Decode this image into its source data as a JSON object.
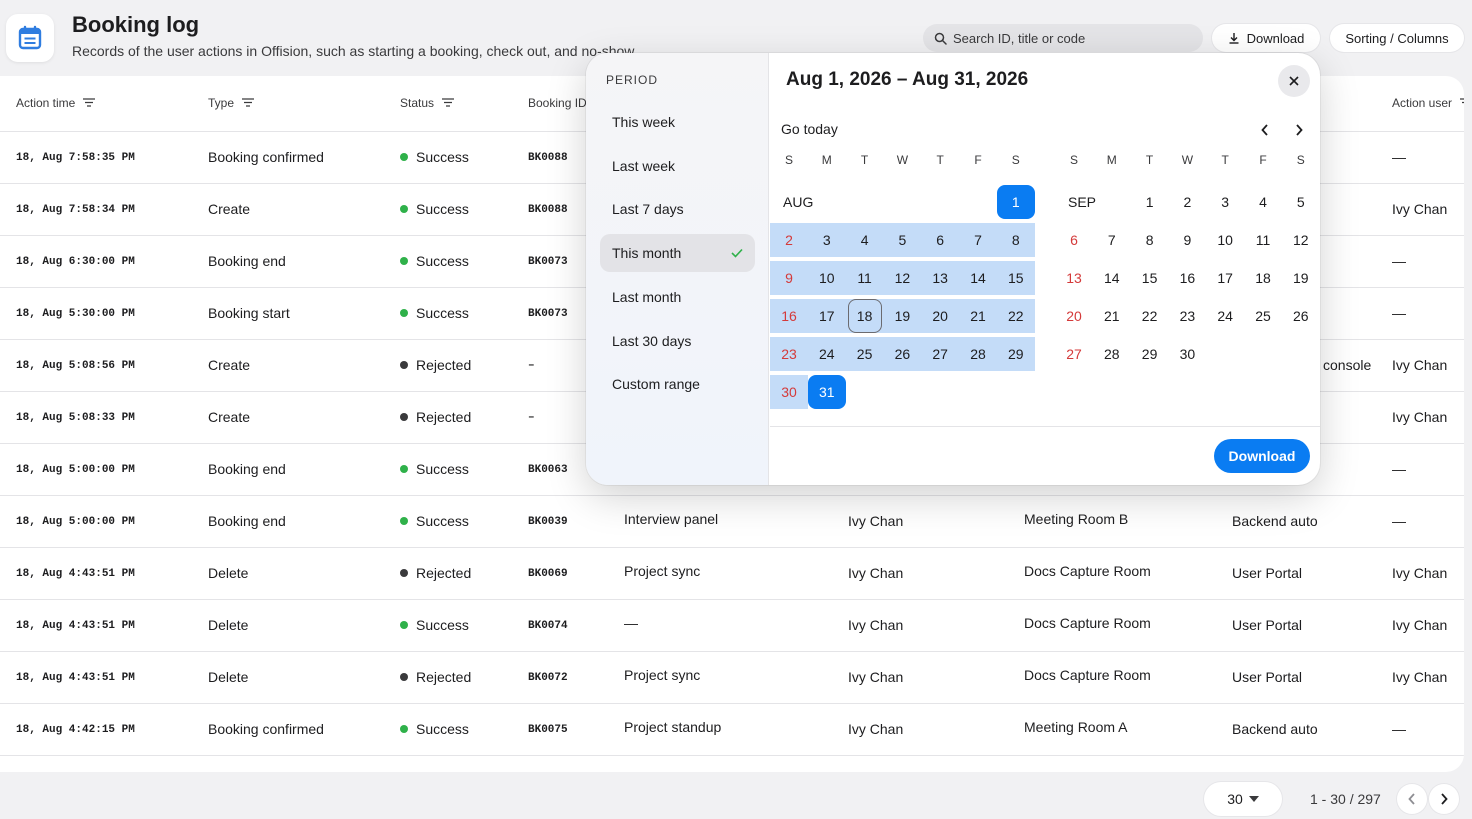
{
  "header": {
    "title": "Booking log",
    "subtitle": "Records of the user actions in Offision, such as starting a booking, check out, and no-show.",
    "search_placeholder": "Search ID, title or code",
    "download_label": "Download",
    "sorting_label": "Sorting / Columns"
  },
  "columns": {
    "action_time": "Action time",
    "type": "Type",
    "status": "Status",
    "booking_id": "Booking ID",
    "action_user": "Action user"
  },
  "rows": [
    {
      "time": "18, Aug 7:58:35 PM",
      "type": "Booking confirmed",
      "status": "Success",
      "code": "BK0088",
      "title": "",
      "user": "",
      "room": "",
      "source": "",
      "action_user": "—"
    },
    {
      "time": "18, Aug 7:58:34 PM",
      "type": "Create",
      "status": "Success",
      "code": "BK0088",
      "title": "",
      "user": "",
      "room": "",
      "source": "",
      "action_user": "Ivy Chan"
    },
    {
      "time": "18, Aug 6:30:00 PM",
      "type": "Booking end",
      "status": "Success",
      "code": "BK0073",
      "title": "",
      "user": "",
      "room": "",
      "source": "",
      "action_user": "—"
    },
    {
      "time": "18, Aug 5:30:00 PM",
      "type": "Booking start",
      "status": "Success",
      "code": "BK0073",
      "title": "",
      "user": "",
      "room": "",
      "source": "",
      "action_user": "—"
    },
    {
      "time": "18, Aug 5:08:56 PM",
      "type": "Create",
      "status": "Rejected",
      "code": "–",
      "title": "",
      "user": "",
      "room": "",
      "source": "console",
      "action_user": "Ivy Chan"
    },
    {
      "time": "18, Aug 5:08:33 PM",
      "type": "Create",
      "status": "Rejected",
      "code": "–",
      "title": "",
      "user": "",
      "room": "",
      "source": "",
      "action_user": "Ivy Chan"
    },
    {
      "time": "18, Aug 5:00:00 PM",
      "type": "Booking end",
      "status": "Success",
      "code": "BK0063",
      "title": "",
      "user": "",
      "room": "",
      "source": "",
      "action_user": "—"
    },
    {
      "time": "18, Aug 5:00:00 PM",
      "type": "Booking end",
      "status": "Success",
      "code": "BK0039",
      "title": "Interview panel",
      "user": "Ivy Chan",
      "room": "Meeting Room B",
      "source": "Backend auto",
      "action_user": "—"
    },
    {
      "time": "18, Aug 4:43:51 PM",
      "type": "Delete",
      "status": "Rejected",
      "code": "BK0069",
      "title": "Project sync",
      "user": "Ivy Chan",
      "room": "Docs Capture Room",
      "source": "User Portal",
      "action_user": "Ivy Chan"
    },
    {
      "time": "18, Aug 4:43:51 PM",
      "type": "Delete",
      "status": "Success",
      "code": "BK0074",
      "title": "—",
      "user": "Ivy Chan",
      "room": "Docs Capture Room",
      "source": "User Portal",
      "action_user": "Ivy Chan"
    },
    {
      "time": "18, Aug 4:43:51 PM",
      "type": "Delete",
      "status": "Rejected",
      "code": "BK0072",
      "title": "Project sync",
      "user": "Ivy Chan",
      "room": "Docs Capture Room",
      "source": "User Portal",
      "action_user": "Ivy Chan"
    },
    {
      "time": "18, Aug 4:42:15 PM",
      "type": "Booking confirmed",
      "status": "Success",
      "code": "BK0075",
      "title": "Project standup",
      "user": "Ivy Chan",
      "room": "Meeting Room A",
      "source": "Backend auto",
      "action_user": "—"
    }
  ],
  "status_colors": {
    "Success": "#2fb14a",
    "Rejected": "#3a3a3c"
  },
  "pagination": {
    "page_size": "30",
    "range": "1 - 30 / 297"
  },
  "popover": {
    "period_label": "PERIOD",
    "periods": [
      "This week",
      "Last week",
      "Last 7 days",
      "This month",
      "Last month",
      "Last 30 days",
      "Custom range"
    ],
    "active_period": "This month",
    "range_title": "Aug 1, 2026 – Aug 31, 2026",
    "go_today": "Go today",
    "weekdays": [
      "S",
      "M",
      "T",
      "W",
      "T",
      "F",
      "S"
    ],
    "months": [
      {
        "label": "AUG",
        "first_weekday": 6,
        "days": 31
      },
      {
        "label": "SEP",
        "first_weekday": 2,
        "days": 30
      }
    ],
    "range_start": 1,
    "range_end": 31,
    "today": 18,
    "download_label": "Download",
    "accent": "#0a7cf2",
    "range_fill": "#c4dcf8"
  }
}
